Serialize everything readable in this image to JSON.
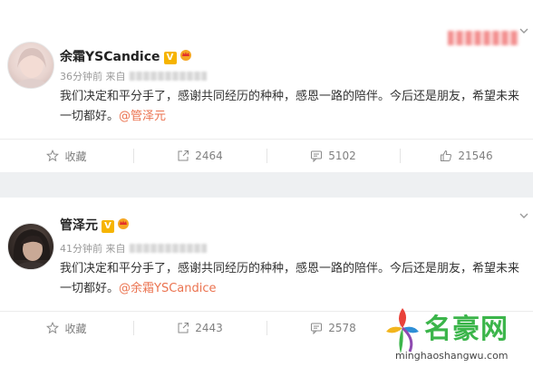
{
  "posts": [
    {
      "author": "余霜YSCandice",
      "verified_badge": "V",
      "time": "36分钟前",
      "source_prefix": "来自",
      "content": "我们决定和平分手了，感谢共同经历的种种，感恩一路的陪伴。今后还是朋友，希望未来一切都好。",
      "mention": "@管泽元",
      "actions": {
        "favorite": "收藏",
        "repost": "2464",
        "comment": "5102",
        "like": "21546"
      }
    },
    {
      "author": "管泽元",
      "verified_badge": "V",
      "time": "41分钟前",
      "source_prefix": "来自",
      "content": "我们决定和平分手了，感谢共同经历的种种，感恩一路的陪伴。今后还是朋友，希望未来一切都好。",
      "mention": "@余霜YSCandice",
      "actions": {
        "favorite": "收藏",
        "repost": "2443",
        "comment": "2578"
      }
    }
  ],
  "watermark": {
    "title": "名豪网",
    "url": "minghaoshangwu.com"
  },
  "colors": {
    "mention": "#eb7350",
    "verified": "#f6b400",
    "watermark": "#3bb54a"
  }
}
